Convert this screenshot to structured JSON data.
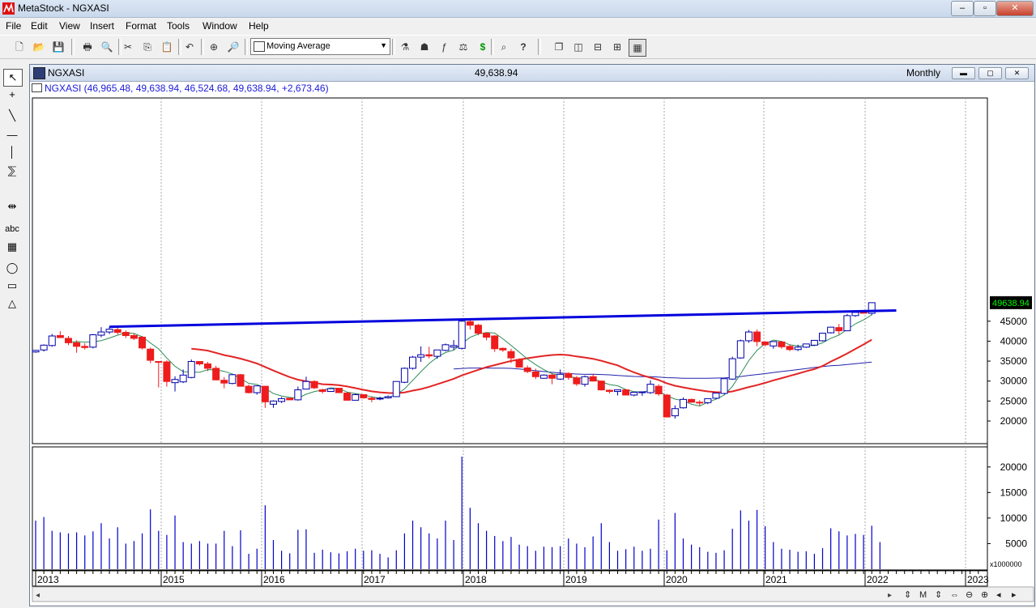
{
  "app": {
    "title": "MetaStock - NGXASI",
    "window_buttons": [
      "–",
      "▫",
      "✕"
    ]
  },
  "menu": [
    "File",
    "Edit",
    "View",
    "Insert",
    "Format",
    "Tools",
    "Window",
    "Help"
  ],
  "toolbar": {
    "indicator_select": "Moving Average"
  },
  "chart_window": {
    "symbol": "NGXASI",
    "last_price": "49,638.94",
    "periodicity": "Monthly",
    "info_line": "NGXASI (46,965.48, 49,638.94, 46,524.68, 49,638.94, +2,673.46)",
    "price_tag": "49638.94",
    "volume_unit": "x1000000"
  },
  "colors": {
    "up_candle_border": "#0000aa",
    "down_candle": "#ee1c1c",
    "ma_fast": "#2e8b57",
    "ma_mid": "#e32424",
    "ma_slow": "#2222aa",
    "trendline": "#0000dd",
    "volume": "#0000cc",
    "price_tag_bg": "#000000",
    "price_tag_fg": "#00ff00"
  },
  "chart_data": {
    "type": "candlestick",
    "y_ticks": [
      20000,
      25000,
      30000,
      35000,
      40000,
      45000
    ],
    "volume_ticks": [
      5000,
      10000,
      15000,
      20000
    ],
    "x_labels": [
      "2013",
      "2015",
      "2016",
      "2017",
      "2018",
      "2019",
      "2020",
      "2021",
      "2022",
      "2023"
    ],
    "candles": [
      {
        "o": 37300,
        "h": 37800,
        "l": 37100,
        "c": 37700
      },
      {
        "o": 37800,
        "h": 39200,
        "l": 37400,
        "c": 39000
      },
      {
        "o": 38900,
        "h": 41800,
        "l": 38600,
        "c": 41300
      },
      {
        "o": 41400,
        "h": 42500,
        "l": 40800,
        "c": 40900
      },
      {
        "o": 40700,
        "h": 41300,
        "l": 39000,
        "c": 39600
      },
      {
        "o": 39600,
        "h": 40200,
        "l": 37100,
        "c": 38700
      },
      {
        "o": 38700,
        "h": 39500,
        "l": 37900,
        "c": 38400
      },
      {
        "o": 38500,
        "h": 41800,
        "l": 38200,
        "c": 41600
      },
      {
        "o": 41500,
        "h": 43500,
        "l": 41000,
        "c": 42300
      },
      {
        "o": 42300,
        "h": 43600,
        "l": 41800,
        "c": 43000
      },
      {
        "o": 42900,
        "h": 43600,
        "l": 41700,
        "c": 42200
      },
      {
        "o": 42200,
        "h": 42700,
        "l": 40800,
        "c": 41400
      },
      {
        "o": 41400,
        "h": 41900,
        "l": 40300,
        "c": 40700
      },
      {
        "o": 41000,
        "h": 41300,
        "l": 37900,
        "c": 38300
      },
      {
        "o": 38000,
        "h": 38400,
        "l": 34500,
        "c": 35200
      },
      {
        "o": 34900,
        "h": 35000,
        "l": 28400,
        "c": 34800
      },
      {
        "o": 34800,
        "h": 35200,
        "l": 28600,
        "c": 29900
      },
      {
        "o": 29600,
        "h": 31200,
        "l": 27400,
        "c": 30400
      },
      {
        "o": 29800,
        "h": 32900,
        "l": 29500,
        "c": 31500
      },
      {
        "o": 30900,
        "h": 35400,
        "l": 30700,
        "c": 34900
      },
      {
        "o": 34900,
        "h": 35000,
        "l": 33900,
        "c": 34300
      },
      {
        "o": 34300,
        "h": 34800,
        "l": 32500,
        "c": 33200
      },
      {
        "o": 33200,
        "h": 33800,
        "l": 30200,
        "c": 30300
      },
      {
        "o": 30200,
        "h": 31000,
        "l": 28200,
        "c": 29500
      },
      {
        "o": 29400,
        "h": 31700,
        "l": 29200,
        "c": 31600
      },
      {
        "o": 31600,
        "h": 31800,
        "l": 28700,
        "c": 28700
      },
      {
        "o": 28700,
        "h": 29100,
        "l": 26900,
        "c": 27100
      },
      {
        "o": 27100,
        "h": 28900,
        "l": 26600,
        "c": 28800
      },
      {
        "o": 28700,
        "h": 28800,
        "l": 23300,
        "c": 24800
      },
      {
        "o": 24200,
        "h": 25200,
        "l": 23300,
        "c": 25000
      },
      {
        "o": 24900,
        "h": 26000,
        "l": 24500,
        "c": 25600
      },
      {
        "o": 25700,
        "h": 25700,
        "l": 25200,
        "c": 25300
      },
      {
        "o": 25300,
        "h": 28600,
        "l": 25100,
        "c": 27800
      },
      {
        "o": 28000,
        "h": 31100,
        "l": 27900,
        "c": 29900
      },
      {
        "o": 29900,
        "h": 30200,
        "l": 28000,
        "c": 28300
      },
      {
        "o": 27800,
        "h": 28100,
        "l": 26900,
        "c": 27400
      },
      {
        "o": 27400,
        "h": 28100,
        "l": 27400,
        "c": 28100
      },
      {
        "o": 28200,
        "h": 28300,
        "l": 27000,
        "c": 27100
      },
      {
        "o": 27000,
        "h": 27200,
        "l": 25100,
        "c": 25200
      },
      {
        "o": 25200,
        "h": 26900,
        "l": 25200,
        "c": 26600
      },
      {
        "o": 26600,
        "h": 26700,
        "l": 25600,
        "c": 25800
      },
      {
        "o": 25700,
        "h": 26200,
        "l": 24700,
        "c": 25400
      },
      {
        "o": 25500,
        "h": 26100,
        "l": 25200,
        "c": 25700
      },
      {
        "o": 25800,
        "h": 26400,
        "l": 25600,
        "c": 26100
      },
      {
        "o": 26100,
        "h": 29900,
        "l": 26000,
        "c": 29900
      },
      {
        "o": 29700,
        "h": 33400,
        "l": 29500,
        "c": 33200
      },
      {
        "o": 33200,
        "h": 36300,
        "l": 32900,
        "c": 36000
      },
      {
        "o": 36000,
        "h": 38700,
        "l": 34800,
        "c": 36600
      },
      {
        "o": 36600,
        "h": 38600,
        "l": 35700,
        "c": 36300
      },
      {
        "o": 36200,
        "h": 37800,
        "l": 35600,
        "c": 37800
      },
      {
        "o": 37700,
        "h": 39400,
        "l": 37500,
        "c": 39100
      },
      {
        "o": 38500,
        "h": 40300,
        "l": 37800,
        "c": 38900
      },
      {
        "o": 38200,
        "h": 45300,
        "l": 37900,
        "c": 45000
      },
      {
        "o": 44900,
        "h": 45200,
        "l": 42900,
        "c": 44000
      },
      {
        "o": 44000,
        "h": 44300,
        "l": 41500,
        "c": 42000
      },
      {
        "o": 42000,
        "h": 42200,
        "l": 40200,
        "c": 41000
      },
      {
        "o": 41300,
        "h": 41500,
        "l": 37300,
        "c": 38100
      },
      {
        "o": 38200,
        "h": 38400,
        "l": 37300,
        "c": 37800
      },
      {
        "o": 37400,
        "h": 38100,
        "l": 34500,
        "c": 35800
      },
      {
        "o": 35400,
        "h": 35700,
        "l": 33700,
        "c": 33500
      },
      {
        "o": 33300,
        "h": 33900,
        "l": 32000,
        "c": 32400
      },
      {
        "o": 32300,
        "h": 33100,
        "l": 30500,
        "c": 31100
      },
      {
        "o": 30700,
        "h": 31700,
        "l": 30600,
        "c": 31500
      },
      {
        "o": 31500,
        "h": 31900,
        "l": 29200,
        "c": 30700
      },
      {
        "o": 30500,
        "h": 32900,
        "l": 30300,
        "c": 31700
      },
      {
        "o": 31900,
        "h": 32200,
        "l": 30300,
        "c": 30900
      },
      {
        "o": 30800,
        "h": 31300,
        "l": 28800,
        "c": 29300
      },
      {
        "o": 29200,
        "h": 31400,
        "l": 28600,
        "c": 31100
      },
      {
        "o": 31100,
        "h": 31700,
        "l": 29900,
        "c": 30000
      },
      {
        "o": 30000,
        "h": 30100,
        "l": 27600,
        "c": 27800
      },
      {
        "o": 27700,
        "h": 27900,
        "l": 26900,
        "c": 27400
      },
      {
        "o": 27400,
        "h": 27900,
        "l": 26400,
        "c": 27800
      },
      {
        "o": 27800,
        "h": 28000,
        "l": 26400,
        "c": 26500
      },
      {
        "o": 26500,
        "h": 27200,
        "l": 26200,
        "c": 27200
      },
      {
        "o": 27200,
        "h": 27300,
        "l": 26300,
        "c": 27300
      },
      {
        "o": 27100,
        "h": 30200,
        "l": 26800,
        "c": 29200
      },
      {
        "o": 28700,
        "h": 29200,
        "l": 26300,
        "c": 26800
      },
      {
        "o": 26500,
        "h": 26800,
        "l": 20900,
        "c": 21000
      },
      {
        "o": 21300,
        "h": 23900,
        "l": 20600,
        "c": 23100
      },
      {
        "o": 23300,
        "h": 25900,
        "l": 23100,
        "c": 25400
      },
      {
        "o": 25400,
        "h": 25600,
        "l": 24600,
        "c": 24700
      },
      {
        "o": 24700,
        "h": 25200,
        "l": 23800,
        "c": 24600
      },
      {
        "o": 24600,
        "h": 25600,
        "l": 24200,
        "c": 25600
      },
      {
        "o": 25700,
        "h": 27100,
        "l": 25500,
        "c": 27000
      },
      {
        "o": 26900,
        "h": 30600,
        "l": 26700,
        "c": 30600
      },
      {
        "o": 30500,
        "h": 36100,
        "l": 30300,
        "c": 35600
      },
      {
        "o": 35800,
        "h": 40400,
        "l": 35600,
        "c": 40100
      },
      {
        "o": 40100,
        "h": 42800,
        "l": 39600,
        "c": 42300
      },
      {
        "o": 42300,
        "h": 42900,
        "l": 38700,
        "c": 39900
      },
      {
        "o": 39800,
        "h": 40000,
        "l": 38700,
        "c": 39100
      },
      {
        "o": 38800,
        "h": 40000,
        "l": 38100,
        "c": 39900
      },
      {
        "o": 39800,
        "h": 40000,
        "l": 38100,
        "c": 38600
      },
      {
        "o": 38700,
        "h": 39200,
        "l": 37500,
        "c": 37900
      },
      {
        "o": 37900,
        "h": 39100,
        "l": 37500,
        "c": 38500
      },
      {
        "o": 38500,
        "h": 39300,
        "l": 38300,
        "c": 39300
      },
      {
        "o": 39000,
        "h": 40300,
        "l": 38800,
        "c": 40200
      },
      {
        "o": 40100,
        "h": 42100,
        "l": 39900,
        "c": 42000
      },
      {
        "o": 42100,
        "h": 43600,
        "l": 41900,
        "c": 43500
      },
      {
        "o": 43400,
        "h": 44300,
        "l": 41700,
        "c": 42600
      },
      {
        "o": 42600,
        "h": 46800,
        "l": 42500,
        "c": 46400
      },
      {
        "o": 46400,
        "h": 47400,
        "l": 46100,
        "c": 47200
      },
      {
        "o": 47200,
        "h": 47800,
        "l": 46900,
        "c": 47000
      },
      {
        "o": 46965.48,
        "h": 49638.94,
        "l": 46524.68,
        "c": 49638.94
      }
    ],
    "volumes": [
      9500,
      10200,
      7500,
      7200,
      7000,
      7200,
      6600,
      7400,
      9000,
      6000,
      8200,
      5000,
      5500,
      7000,
      11700,
      7500,
      6700,
      10500,
      5300,
      5000,
      5500,
      5000,
      5000,
      7500,
      4500,
      7600,
      3000,
      4000,
      12500,
      5700,
      3600,
      3100,
      7700,
      7800,
      3200,
      3800,
      3300,
      3100,
      3500,
      4000,
      3600,
      3700,
      3000,
      2300,
      3700,
      7000,
      9500,
      8200,
      7000,
      6000,
      9500,
      5700,
      22000,
      12000,
      9000,
      7500,
      6500,
      5500,
      6300,
      4800,
      4500,
      3600,
      4400,
      4300,
      4500,
      6000,
      5000,
      4300,
      6400,
      9000,
      5300,
      3600,
      3900,
      4400,
      3600,
      4000,
      9700,
      3700,
      11000,
      6000,
      4800,
      4300,
      3400,
      3200,
      3700,
      7900,
      11500,
      9500,
      11600,
      8400,
      5300,
      4000,
      3800,
      3400,
      3500,
      3000,
      4100,
      8000,
      7400,
      6600,
      6900,
      6700,
      8500,
      5300
    ],
    "trendline": [
      {
        "i": 9,
        "y": 43600
      },
      {
        "i": 104,
        "y": 47700
      }
    ]
  }
}
